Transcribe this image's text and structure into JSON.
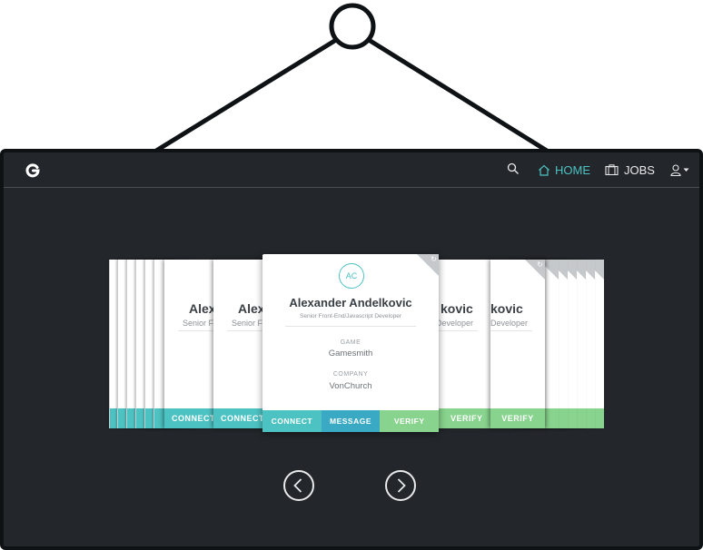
{
  "nav": {
    "home_label": "HOME",
    "jobs_label": "JOBS"
  },
  "main_card": {
    "initials": "AC",
    "name": "Alexander Andelkovic",
    "role": "Senior Front-End/Javascript Developer",
    "game_label": "GAME",
    "game_value": "Gamesmith",
    "company_label": "COMPANY",
    "company_value": "VonChurch",
    "connect_label": "CONNECT",
    "message_label": "MESSAGE",
    "verify_label": "VERIFY"
  },
  "left_cards": [
    {
      "name_fragment": "Alex",
      "role_fragment": "Senior Fr",
      "button_label": "CONNECT"
    },
    {
      "name_fragment": "Alex",
      "role_fragment": "Senior Fr",
      "button_label": "CONNECT"
    }
  ],
  "right_cards": [
    {
      "name_fragment": "kovic",
      "role_fragment": "Developer",
      "button_label": "VERIFY"
    },
    {
      "name_fragment": "kovic",
      "role_fragment": "Developer",
      "button_label": "VERIFY"
    }
  ],
  "icons": {
    "logo": "logo-icon",
    "search": "search-icon",
    "home": "home-icon",
    "jobs": "briefcase-icon",
    "user": "user-icon",
    "prev": "chevron-left-icon",
    "next": "chevron-right-icon",
    "corner": "refresh-icon"
  },
  "colors": {
    "teal": "#4dc2c3",
    "message_blue": "#3aa9c3",
    "verify_green": "#88d38d",
    "frame_bg": "#23272b"
  }
}
